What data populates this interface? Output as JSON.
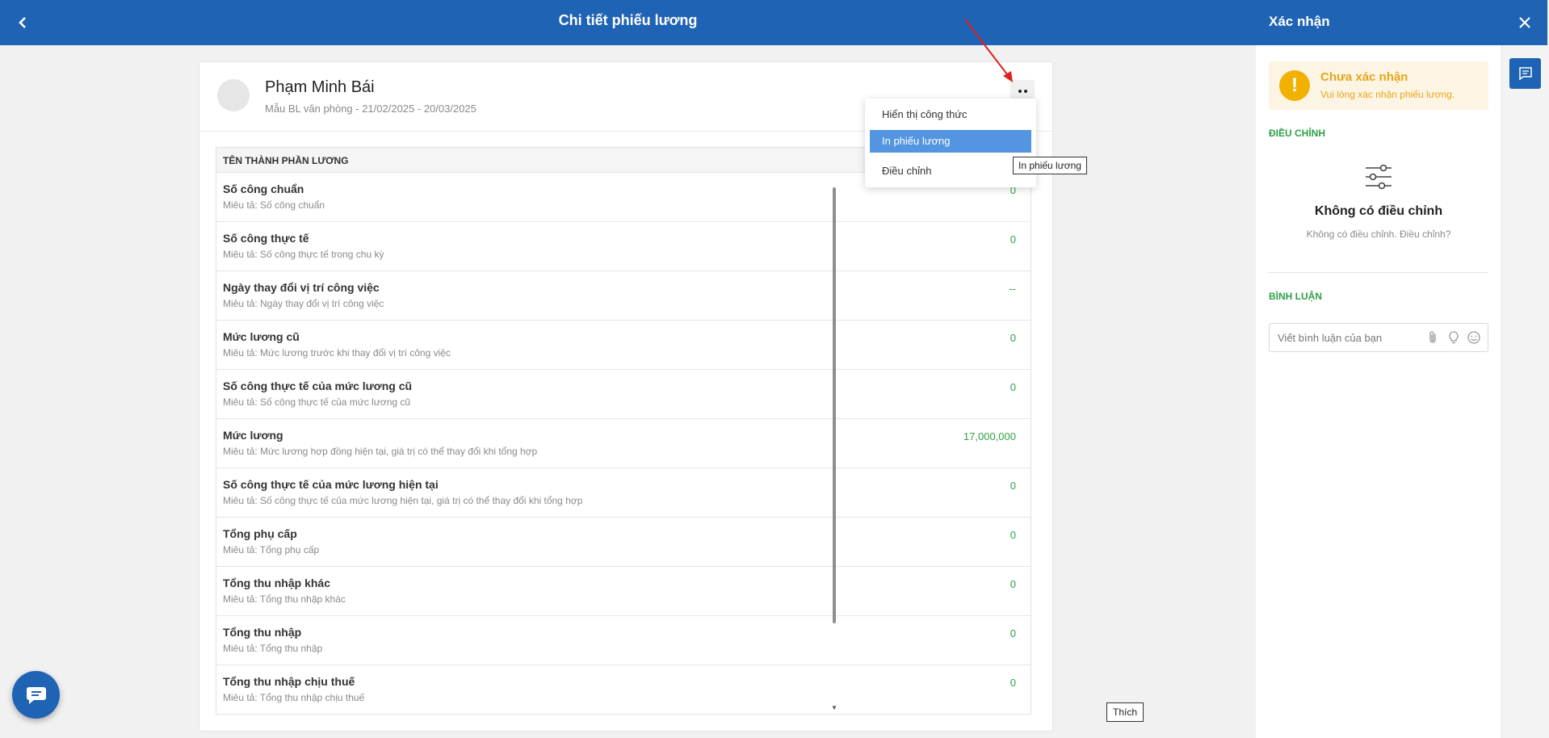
{
  "header": {
    "title": "Chi tiết phiếu lương"
  },
  "employee": {
    "name": "Phạm Minh Bái",
    "subtitle": "Mẫu BL văn phòng - 21/02/2025 - 20/03/2025"
  },
  "table": {
    "header": "TÊN THÀNH PHẦN LƯƠNG",
    "rows": [
      {
        "label": "Số công chuẩn",
        "desc": "Miêu tả: Số công chuẩn",
        "value": "0"
      },
      {
        "label": "Số công thực tế",
        "desc": "Miêu tả: Số công thực tế trong chu kỳ",
        "value": "0"
      },
      {
        "label": "Ngày thay đổi vị trí công việc",
        "desc": "Miêu tả: Ngày thay đổi vị trí công việc",
        "value": "--"
      },
      {
        "label": "Mức lương cũ",
        "desc": "Miêu tả: Mức lương trước khi thay đổi vị trí công việc",
        "value": "0"
      },
      {
        "label": "Số công thực tế của mức lương cũ",
        "desc": "Miêu tả: Số công thực tế của mức lương cũ",
        "value": "0"
      },
      {
        "label": "Mức lương",
        "desc": "Miêu tả: Mức lương hợp đồng hiện tại, giá trị có thể thay đổi khi tổng hợp",
        "value": "17,000,000"
      },
      {
        "label": "Số công thực tế của mức lương hiện tại",
        "desc": "Miêu tả: Số công thực tế của mức lương hiện tại, giá trị có thể thay đổi khi tổng hợp",
        "value": "0"
      },
      {
        "label": "Tổng phụ cấp",
        "desc": "Miêu tả: Tổng phụ cấp",
        "value": "0"
      },
      {
        "label": "Tổng thu nhập khác",
        "desc": "Miêu tả: Tổng thu nhập khác",
        "value": "0"
      },
      {
        "label": "Tổng thu nhập",
        "desc": "Miêu tả: Tổng thu nhập",
        "value": "0"
      },
      {
        "label": "Tổng thu nhập chịu thuế",
        "desc": "Miêu tả: Tổng thu nhập chịu thuế",
        "value": "0"
      }
    ]
  },
  "menu": {
    "items": [
      {
        "label": "Hiển thị công thức"
      },
      {
        "label": "In phiếu lương"
      },
      {
        "label": "Điều chỉnh"
      }
    ],
    "active_index": 1,
    "tooltip": "In phiếu lương"
  },
  "confirm_panel": {
    "title": "Xác nhận",
    "status_title": "Chưa xác nhận",
    "status_sub": "Vui lòng xác nhận phiếu lương.",
    "adjust_label": "ĐIỀU CHỈNH",
    "empty_title": "Không có điều chỉnh",
    "empty_sub": "Không có điều chỉnh. Điều chỉnh?",
    "comment_label": "BÌNH LUẬN",
    "comment_placeholder": "Viết bình luận của bạn"
  },
  "tooltip_like": "Thích",
  "colors": {
    "primary": "#1f63b5",
    "value_green": "#2e9f47",
    "warning": "#f2b100",
    "menu_active": "#5395e0"
  }
}
